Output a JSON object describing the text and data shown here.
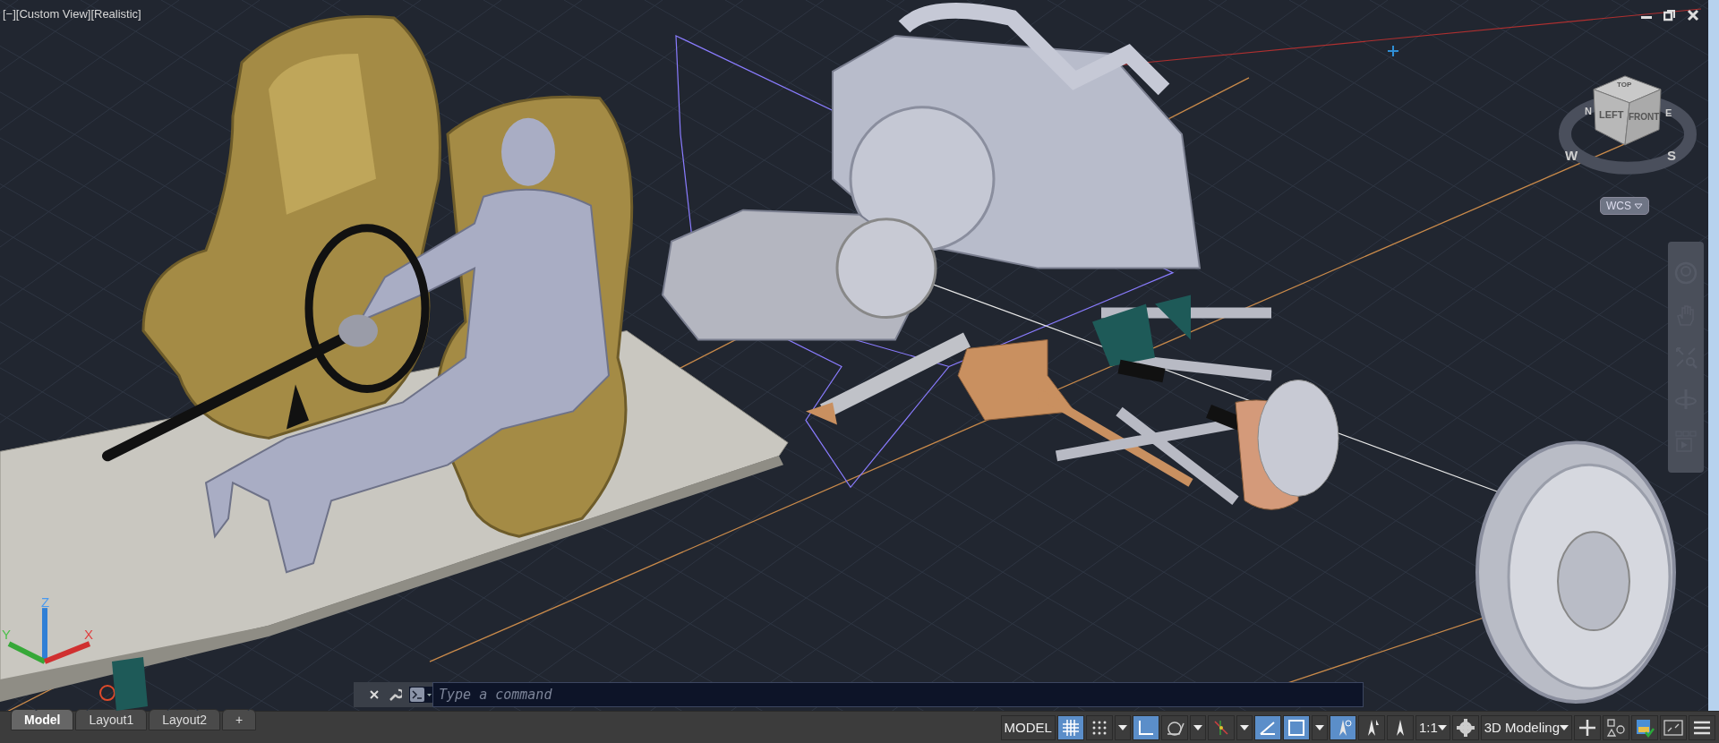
{
  "viewport": {
    "label": "[−][Custom View][Realistic]"
  },
  "view_cube": {
    "faces": [
      "TOP",
      "LEFT",
      "FRONT"
    ],
    "compass": [
      "N",
      "E",
      "W",
      "S"
    ],
    "coordinate_system": "WCS"
  },
  "ucs_icon": {
    "axes": [
      "Z",
      "Y",
      "X"
    ]
  },
  "command_line": {
    "placeholder": "Type a command"
  },
  "layout_tabs": [
    {
      "label": "Model",
      "selected": true
    },
    {
      "label": "Layout1",
      "selected": false
    },
    {
      "label": "Layout2",
      "selected": false
    },
    {
      "label": "+",
      "selected": false
    }
  ],
  "status_bar": [
    {
      "kind": "label",
      "text": "MODEL"
    },
    {
      "kind": "grid",
      "on": true
    },
    {
      "kind": "snap",
      "on": false
    },
    {
      "kind": "caret"
    },
    {
      "kind": "ortho",
      "on": true
    },
    {
      "kind": "polar",
      "on": false
    },
    {
      "kind": "caret"
    },
    {
      "kind": "osnap",
      "on": false
    },
    {
      "kind": "caret"
    },
    {
      "kind": "dynucs",
      "on": true
    },
    {
      "kind": "selcycle",
      "on": true
    },
    {
      "kind": "caret"
    },
    {
      "kind": "annovis",
      "on": true
    },
    {
      "kind": "autoscale",
      "on": false
    },
    {
      "kind": "annoscale",
      "on": false
    },
    {
      "kind": "scale",
      "text": "1:1"
    },
    {
      "kind": "gear",
      "on": false
    },
    {
      "kind": "workspace",
      "text": "3D Modeling"
    },
    {
      "kind": "plus",
      "on": false
    },
    {
      "kind": "isolate",
      "on": false
    },
    {
      "kind": "hwaccel",
      "on": false
    },
    {
      "kind": "fullscreen",
      "on": false
    },
    {
      "kind": "menu",
      "on": false
    }
  ]
}
